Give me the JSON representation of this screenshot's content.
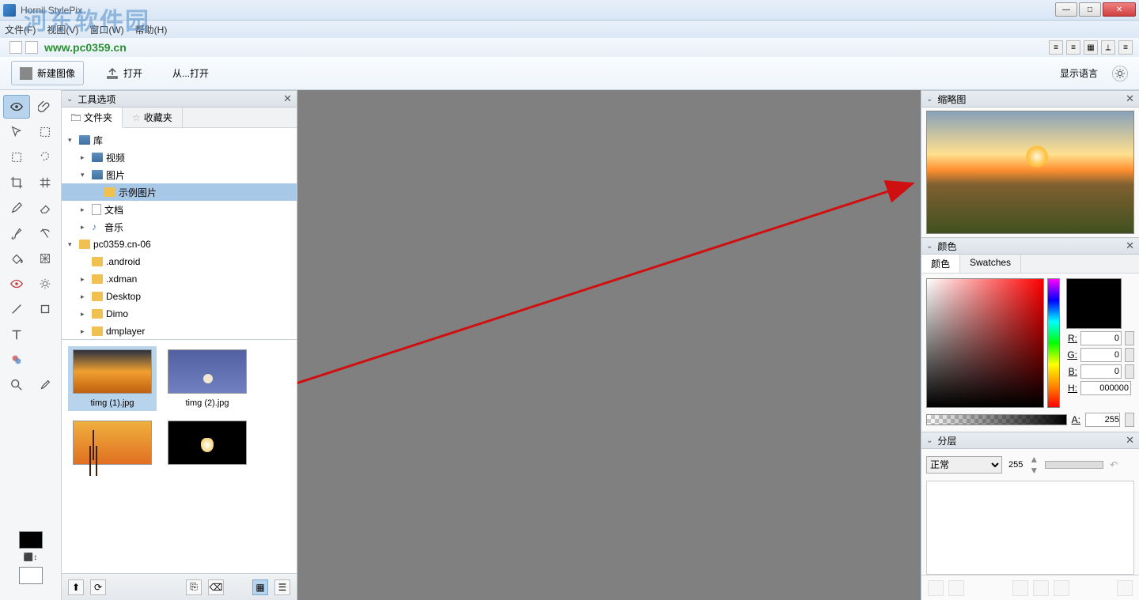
{
  "window": {
    "title": "Hornil StylePix",
    "minimize": "—",
    "maximize": "□",
    "close": "✕"
  },
  "menu": {
    "file": "文件(F)",
    "view": "视图(V)",
    "window": "窗口(W)",
    "help": "帮助(H)"
  },
  "watermark_url": "www.pc0359.cn",
  "watermark_text": "河东软件园",
  "toolbar": {
    "new_image": "新建图像",
    "open": "打开",
    "open_from": "从...打开",
    "display_lang": "显示语言"
  },
  "left_panel": {
    "title": "工具选项",
    "tab_folder": "文件夹",
    "tab_fav": "收藏夹"
  },
  "tree": [
    {
      "label": "库",
      "depth": 0,
      "arrow": "▾",
      "icon": "lib"
    },
    {
      "label": "视频",
      "depth": 1,
      "arrow": "▸",
      "icon": "lib"
    },
    {
      "label": "图片",
      "depth": 1,
      "arrow": "▾",
      "icon": "lib"
    },
    {
      "label": "示例图片",
      "depth": 2,
      "arrow": "",
      "icon": "folder",
      "sel": true
    },
    {
      "label": "文档",
      "depth": 1,
      "arrow": "▸",
      "icon": "file"
    },
    {
      "label": "音乐",
      "depth": 1,
      "arrow": "▸",
      "icon": "music"
    },
    {
      "label": "pc0359.cn-06",
      "depth": 0,
      "arrow": "▾",
      "icon": "folder"
    },
    {
      "label": ".android",
      "depth": 1,
      "arrow": "",
      "icon": "folder"
    },
    {
      "label": ".xdman",
      "depth": 1,
      "arrow": "▸",
      "icon": "folder"
    },
    {
      "label": "Desktop",
      "depth": 1,
      "arrow": "▸",
      "icon": "folder"
    },
    {
      "label": "Dimo",
      "depth": 1,
      "arrow": "▸",
      "icon": "folder"
    },
    {
      "label": "dmplayer",
      "depth": 1,
      "arrow": "▸",
      "icon": "folder"
    }
  ],
  "thumbs": [
    {
      "name": "timg (1).jpg",
      "cls": "img-sunset",
      "sel": true
    },
    {
      "name": "timg (2).jpg",
      "cls": "img-moon",
      "sel": false
    },
    {
      "name": "",
      "cls": "img-eiffel",
      "sel": false
    },
    {
      "name": "",
      "cls": "img-dark",
      "sel": false
    }
  ],
  "right": {
    "thumbnail_title": "缩略图",
    "color_title": "颜色",
    "color_tab": "颜色",
    "swatches_tab": "Swatches",
    "r_label": "R:",
    "r_val": "0",
    "g_label": "G:",
    "g_val": "0",
    "b_label": "B:",
    "b_val": "0",
    "h_label": "H:",
    "h_val": "000000",
    "a_label": "A:",
    "a_val": "255",
    "layers_title": "分层",
    "blend_mode": "正常",
    "opacity": "255"
  }
}
